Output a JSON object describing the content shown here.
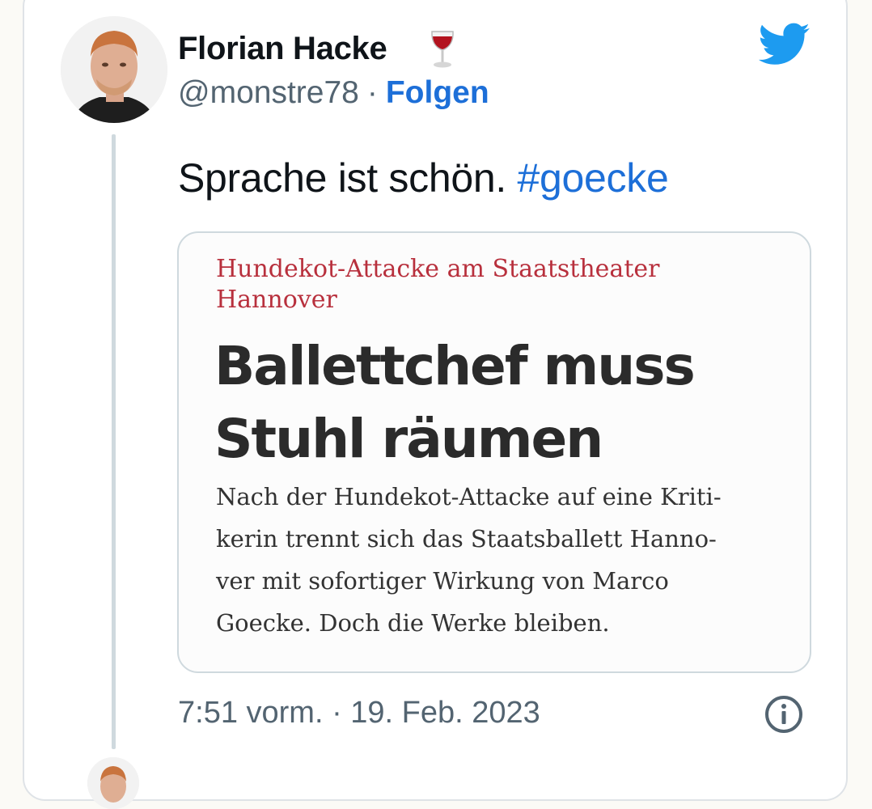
{
  "tweet": {
    "author_name": "Florian Hacke",
    "author_emoji_icon": "wine-glass-icon",
    "handle": "@monstre78",
    "separator": "·",
    "follow_label": "Folgen",
    "brand_icon": "twitter-bird-icon",
    "text": "Sprache ist schön.",
    "hashtag": "#goecke",
    "timestamp": "7:51 vorm. · 19. Feb. 2023",
    "info_icon": "info-icon"
  },
  "media_card": {
    "kicker": "Hundekot-Attacke am Staatstheater Hannover",
    "headline_lines": [
      "Ballettchef muss",
      "Stuhl räumen"
    ],
    "teaser_lines": [
      "Nach der Hundekot-Attacke auf eine Kriti-",
      "kerin trennt sich das Staatsballett Hanno-",
      "ver mit sofortiger Wirkung von Marco",
      "Goecke. Doch die Werke bleiben."
    ]
  },
  "colors": {
    "link_blue": "#1d6fd8",
    "twitter_blue": "#1d9bf0",
    "kicker_red": "#b8303d",
    "muted_gray": "#536471"
  }
}
